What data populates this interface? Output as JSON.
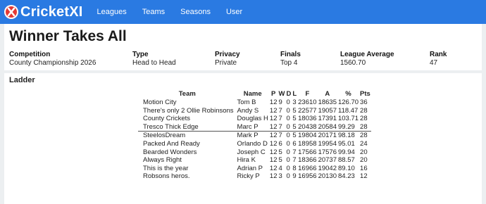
{
  "app": {
    "brand": "CricketXI",
    "nav": [
      "Leagues",
      "Teams",
      "Seasons",
      "User"
    ]
  },
  "page": {
    "title": "Winner Takes All"
  },
  "stats": [
    {
      "label": "Competition",
      "value": "County Championship 2026"
    },
    {
      "label": "Type",
      "value": "Head to Head"
    },
    {
      "label": "Privacy",
      "value": "Private"
    },
    {
      "label": "Finals",
      "value": "Top 4"
    },
    {
      "label": "League Average",
      "value": "1560.70"
    },
    {
      "label": "Rank",
      "value": "47"
    }
  ],
  "ladder": {
    "title": "Ladder",
    "headers": [
      "Team",
      "Name",
      "P",
      "W",
      "D",
      "L",
      "F",
      "A",
      "%",
      "Pts"
    ],
    "rows": [
      [
        "Motion City",
        "Tom B",
        "12",
        "9",
        "0",
        "3",
        "23610",
        "18635",
        "126.70",
        "36"
      ],
      [
        "There's only 2 Ollie Robinsons",
        "Andy S",
        "12",
        "7",
        "0",
        "5",
        "22577",
        "19057",
        "118.47",
        "28"
      ],
      [
        "County Crickets",
        "Douglas H",
        "12",
        "7",
        "0",
        "5",
        "18036",
        "17391",
        "103.71",
        "28"
      ],
      [
        "Tresco Thick Edge",
        "Marc P",
        "12",
        "7",
        "0",
        "5",
        "20438",
        "20584",
        "99.29",
        "28"
      ],
      [
        "SteelosDream",
        "Mark P",
        "12",
        "7",
        "0",
        "5",
        "19804",
        "20171",
        "98.18",
        "28"
      ],
      [
        "Packed And Ready",
        "Orlando D",
        "12",
        "6",
        "0",
        "6",
        "18958",
        "19954",
        "95.01",
        "24"
      ],
      [
        "Bearded Wonders",
        "Joseph C",
        "12",
        "5",
        "0",
        "7",
        "17566",
        "17576",
        "99.94",
        "20"
      ],
      [
        "Always Right",
        "Hira K",
        "12",
        "5",
        "0",
        "7",
        "18366",
        "20737",
        "88.57",
        "20"
      ],
      [
        "This is the year",
        "Adrian P",
        "12",
        "4",
        "0",
        "8",
        "16966",
        "19042",
        "89.10",
        "16"
      ],
      [
        "Robsons heros.",
        "Ricky P",
        "12",
        "3",
        "0",
        "9",
        "16956",
        "20130",
        "84.23",
        "12"
      ]
    ]
  }
}
